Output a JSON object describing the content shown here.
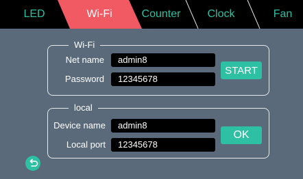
{
  "tabs": [
    {
      "label": "LED"
    },
    {
      "label": "Wi-Fi",
      "active": true
    },
    {
      "label": "Counter"
    },
    {
      "label": "Clock"
    },
    {
      "label": "Fan"
    }
  ],
  "wifi": {
    "title": "Wi-Fi",
    "net_name_label": "Net name",
    "net_name_value": "admin8",
    "password_label": "Password",
    "password_value": "12345678",
    "start_label": "START"
  },
  "local": {
    "title": "local",
    "device_name_label": "Device name",
    "device_name_value": "admin8",
    "local_port_label": "Local port",
    "local_port_value": "12345678",
    "ok_label": "OK"
  },
  "colors": {
    "accent": "#2ec0a2",
    "active_tab": "#f25a63",
    "background": "#5a6a7a"
  },
  "icons": {
    "back": "back-arrow-icon"
  }
}
